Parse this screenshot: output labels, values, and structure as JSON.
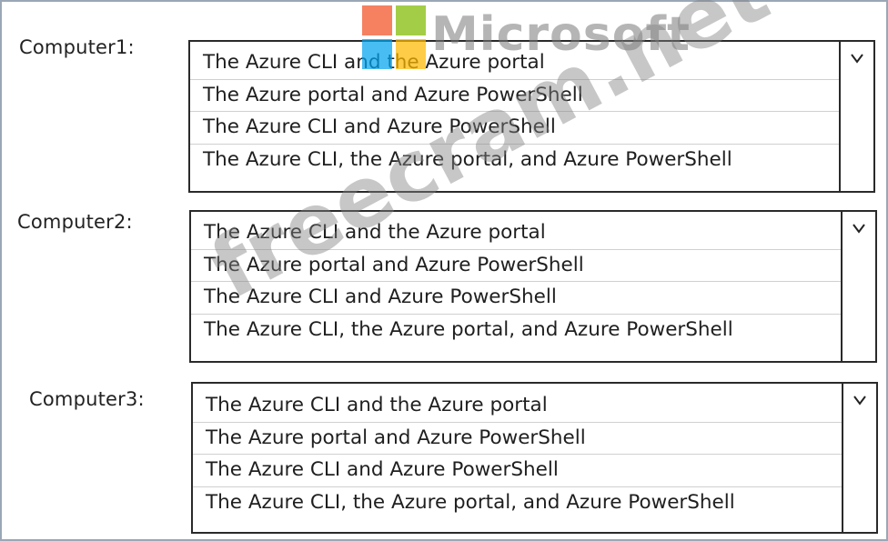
{
  "watermark": {
    "logo_text": "Microsoft",
    "site_text": "freecram.net",
    "colors": [
      "#f25022",
      "#7fba00",
      "#00a4ef",
      "#ffb900"
    ]
  },
  "computers": [
    {
      "label": "Computer1:",
      "options": [
        "The Azure CLI and the Azure portal",
        "The Azure portal and Azure PowerShell",
        "The Azure CLI and Azure PowerShell",
        "The Azure CLI, the Azure portal, and Azure PowerShell"
      ]
    },
    {
      "label": "Computer2:",
      "options": [
        "The Azure CLI and the Azure portal",
        "The Azure portal and Azure PowerShell",
        "The Azure CLI and Azure PowerShell",
        "The Azure CLI, the Azure portal, and Azure PowerShell"
      ]
    },
    {
      "label": "Computer3:",
      "options": [
        "The Azure CLI and the Azure portal",
        "The Azure portal and Azure PowerShell",
        "The Azure CLI and Azure PowerShell",
        "The Azure CLI, the Azure portal, and Azure PowerShell"
      ]
    }
  ]
}
